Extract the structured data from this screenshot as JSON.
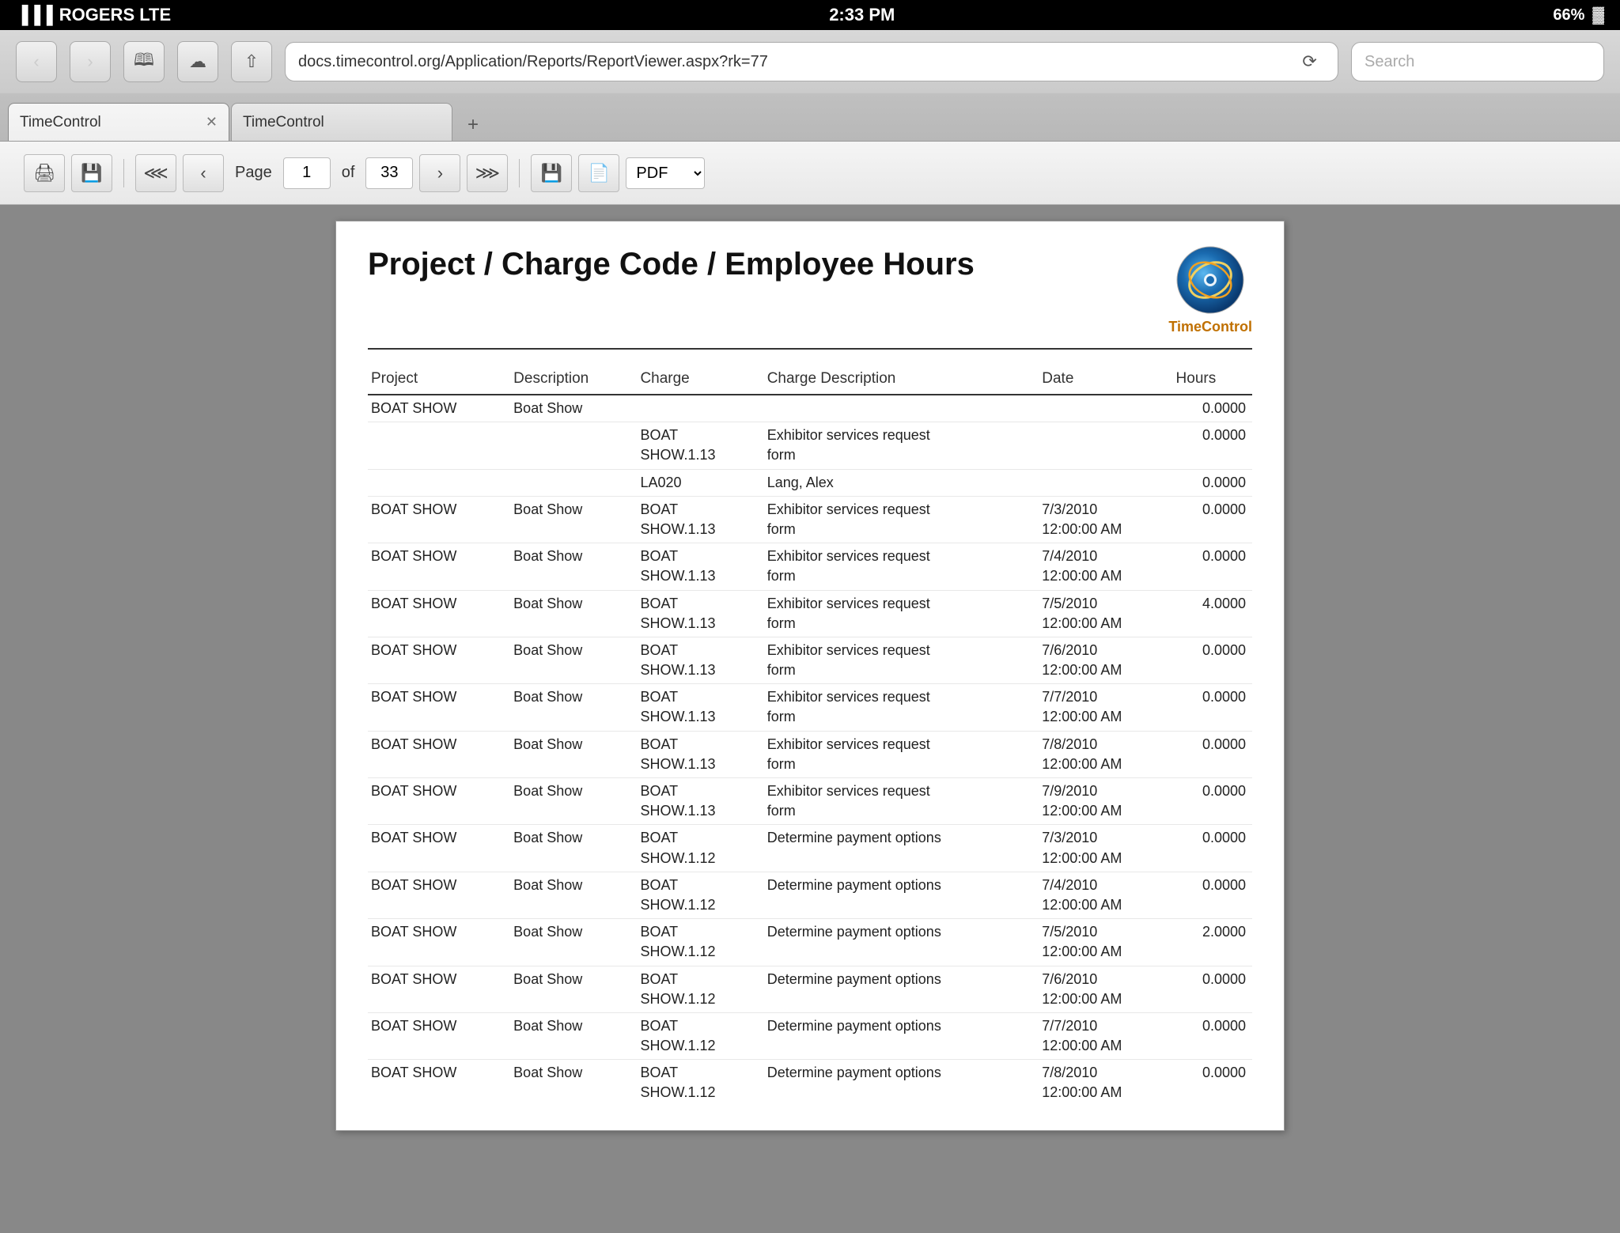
{
  "statusBar": {
    "carrier": "ROGERS  LTE",
    "time": "2:33 PM",
    "battery": "66%"
  },
  "browser": {
    "url": "docs.timecontrol.org/Application/Reports/ReportViewer.aspx?rk=77",
    "searchPlaceholder": "Search",
    "tabs": [
      {
        "id": 1,
        "label": "TimeControl",
        "active": true
      },
      {
        "id": 2,
        "label": "TimeControl",
        "active": false
      }
    ]
  },
  "toolbar": {
    "pageLabel": "Page",
    "currentPage": "1",
    "ofLabel": "of",
    "totalPages": "33",
    "format": "PDF"
  },
  "report": {
    "title": "Project / Charge Code / Employee Hours",
    "logoName": "TimeControl",
    "columns": {
      "project": "Project",
      "description": "Description",
      "charge": "Charge",
      "chargeDescription": "Charge Description",
      "date": "Date",
      "hours": "Hours"
    },
    "rows": [
      {
        "project": "BOAT SHOW",
        "description": "Boat Show",
        "charge": "",
        "chargeDescription": "",
        "date": "",
        "hours": "0.0000",
        "level": 1
      },
      {
        "project": "",
        "description": "",
        "charge": "BOAT\nSHOW.1.13",
        "chargeDescription": "Exhibitor services request\nform",
        "date": "",
        "hours": "0.0000",
        "level": 2
      },
      {
        "project": "",
        "description": "",
        "charge": "LA020",
        "chargeDescription": "Lang, Alex",
        "date": "",
        "hours": "0.0000",
        "level": 3
      },
      {
        "project": "BOAT SHOW",
        "description": "Boat Show",
        "charge": "BOAT\nSHOW.1.13",
        "chargeDescription": "Exhibitor services request\nform",
        "date": "7/3/2010\n12:00:00 AM",
        "hours": "0.0000",
        "level": 4
      },
      {
        "project": "BOAT SHOW",
        "description": "Boat Show",
        "charge": "BOAT\nSHOW.1.13",
        "chargeDescription": "Exhibitor services request\nform",
        "date": "7/4/2010\n12:00:00 AM",
        "hours": "0.0000",
        "level": 4
      },
      {
        "project": "BOAT SHOW",
        "description": "Boat Show",
        "charge": "BOAT\nSHOW.1.13",
        "chargeDescription": "Exhibitor services request\nform",
        "date": "7/5/2010\n12:00:00 AM",
        "hours": "4.0000",
        "level": 4
      },
      {
        "project": "BOAT SHOW",
        "description": "Boat Show",
        "charge": "BOAT\nSHOW.1.13",
        "chargeDescription": "Exhibitor services request\nform",
        "date": "7/6/2010\n12:00:00 AM",
        "hours": "0.0000",
        "level": 4
      },
      {
        "project": "BOAT SHOW",
        "description": "Boat Show",
        "charge": "BOAT\nSHOW.1.13",
        "chargeDescription": "Exhibitor services request\nform",
        "date": "7/7/2010\n12:00:00 AM",
        "hours": "0.0000",
        "level": 4
      },
      {
        "project": "BOAT SHOW",
        "description": "Boat Show",
        "charge": "BOAT\nSHOW.1.13",
        "chargeDescription": "Exhibitor services request\nform",
        "date": "7/8/2010\n12:00:00 AM",
        "hours": "0.0000",
        "level": 4
      },
      {
        "project": "BOAT SHOW",
        "description": "Boat Show",
        "charge": "BOAT\nSHOW.1.13",
        "chargeDescription": "Exhibitor services request\nform",
        "date": "7/9/2010\n12:00:00 AM",
        "hours": "0.0000",
        "level": 4
      },
      {
        "project": "BOAT SHOW",
        "description": "Boat Show",
        "charge": "BOAT\nSHOW.1.12",
        "chargeDescription": "Determine payment options",
        "date": "7/3/2010\n12:00:00 AM",
        "hours": "0.0000",
        "level": 4
      },
      {
        "project": "BOAT SHOW",
        "description": "Boat Show",
        "charge": "BOAT\nSHOW.1.12",
        "chargeDescription": "Determine payment options",
        "date": "7/4/2010\n12:00:00 AM",
        "hours": "0.0000",
        "level": 4
      },
      {
        "project": "BOAT SHOW",
        "description": "Boat Show",
        "charge": "BOAT\nSHOW.1.12",
        "chargeDescription": "Determine payment options",
        "date": "7/5/2010\n12:00:00 AM",
        "hours": "2.0000",
        "level": 4
      },
      {
        "project": "BOAT SHOW",
        "description": "Boat Show",
        "charge": "BOAT\nSHOW.1.12",
        "chargeDescription": "Determine payment options",
        "date": "7/6/2010\n12:00:00 AM",
        "hours": "0.0000",
        "level": 4
      },
      {
        "project": "BOAT SHOW",
        "description": "Boat Show",
        "charge": "BOAT\nSHOW.1.12",
        "chargeDescription": "Determine payment options",
        "date": "7/7/2010\n12:00:00 AM",
        "hours": "0.0000",
        "level": 4
      },
      {
        "project": "BOAT SHOW",
        "description": "Boat Show",
        "charge": "BOAT\nSHOW.1.12",
        "chargeDescription": "Determine payment options",
        "date": "7/8/2010\n12:00:00 AM",
        "hours": "0.0000",
        "level": 4
      }
    ]
  }
}
